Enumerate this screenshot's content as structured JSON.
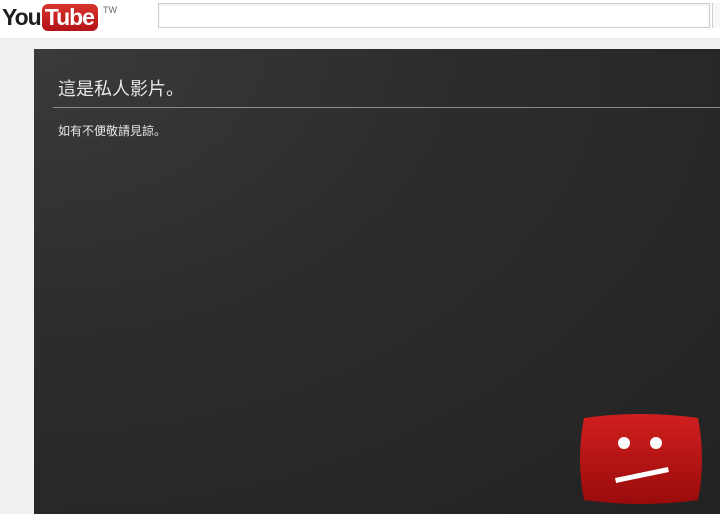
{
  "header": {
    "logo_you": "You",
    "logo_tube": "Tube",
    "logo_region": "TW",
    "search_value": "",
    "search_placeholder": ""
  },
  "error": {
    "title": "這是私人影片。",
    "subtitle": "如有不便敬請見諒。",
    "icon": "sad-tv-icon"
  },
  "colors": {
    "brand_red": "#cc181e",
    "player_background": "#2b2b2b",
    "text": "#e6e6e6"
  }
}
